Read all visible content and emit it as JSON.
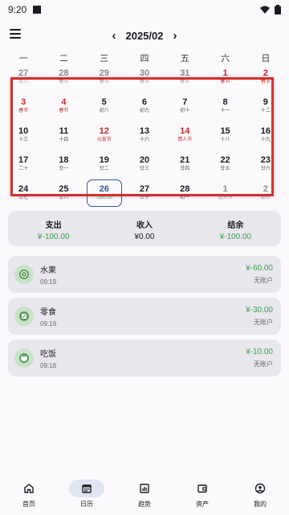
{
  "status": {
    "time": "9:20"
  },
  "header": {
    "month": "2025/02",
    "prev_icon": "chevron-left-icon",
    "next_icon": "chevron-right-icon",
    "menu_icon": "menu-icon"
  },
  "weekdays": [
    "一",
    "二",
    "三",
    "四",
    "五",
    "六",
    "日"
  ],
  "days": [
    {
      "d": "27",
      "s": "廿八",
      "muted": true
    },
    {
      "d": "28",
      "s": "春节",
      "muted": true
    },
    {
      "d": "29",
      "s": "春节",
      "muted": true
    },
    {
      "d": "30",
      "s": "春节",
      "muted": true
    },
    {
      "d": "31",
      "s": "春节",
      "muted": true
    },
    {
      "d": "1",
      "s": "春节",
      "red": true,
      "fest": true
    },
    {
      "d": "2",
      "s": "春节",
      "red": true,
      "fest": true
    },
    {
      "d": "3",
      "s": "春节",
      "red": true,
      "fest": true
    },
    {
      "d": "4",
      "s": "春节",
      "red": true,
      "fest": true
    },
    {
      "d": "5",
      "s": "初八"
    },
    {
      "d": "6",
      "s": "初九"
    },
    {
      "d": "7",
      "s": "初十"
    },
    {
      "d": "8",
      "s": "十一"
    },
    {
      "d": "9",
      "s": "十二"
    },
    {
      "d": "10",
      "s": "十三"
    },
    {
      "d": "11",
      "s": "十四"
    },
    {
      "d": "12",
      "s": "元宵节",
      "red": true,
      "fest": true
    },
    {
      "d": "13",
      "s": "十六"
    },
    {
      "d": "14",
      "s": "情人节",
      "red": true,
      "fest": true
    },
    {
      "d": "15",
      "s": "十八"
    },
    {
      "d": "16",
      "s": "十九"
    },
    {
      "d": "17",
      "s": "二十"
    },
    {
      "d": "18",
      "s": "廿一"
    },
    {
      "d": "19",
      "s": "廿二"
    },
    {
      "d": "20",
      "s": "廿三"
    },
    {
      "d": "21",
      "s": "廿四"
    },
    {
      "d": "22",
      "s": "廿五"
    },
    {
      "d": "23",
      "s": "廿六"
    },
    {
      "d": "24",
      "s": "廿七"
    },
    {
      "d": "25",
      "s": "廿八"
    },
    {
      "d": "26",
      "s": "-100.00",
      "today": true
    },
    {
      "d": "27",
      "s": "三十"
    },
    {
      "d": "28",
      "s": "初一"
    },
    {
      "d": "1",
      "s": "龙头节",
      "muted": true
    },
    {
      "d": "2",
      "s": "初三",
      "muted": true
    }
  ],
  "summary": {
    "expense_label": "支出",
    "expense_value": "¥-100.00",
    "income_label": "收入",
    "income_value": "¥0.00",
    "balance_label": "结余",
    "balance_value": "¥-100.00"
  },
  "records": [
    {
      "icon": "fruit-icon",
      "title": "水果",
      "time": "09:19",
      "amount": "¥-60.00",
      "account": "无账户"
    },
    {
      "icon": "snack-icon",
      "title": "零食",
      "time": "09:19",
      "amount": "¥-30.00",
      "account": "无账户"
    },
    {
      "icon": "meal-icon",
      "title": "吃饭",
      "time": "09:18",
      "amount": "¥-10.00",
      "account": "无账户"
    }
  ],
  "nav": [
    {
      "label": "首页",
      "icon": "home-icon"
    },
    {
      "label": "日历",
      "icon": "calendar-icon",
      "active": true
    },
    {
      "label": "趋势",
      "icon": "chart-icon"
    },
    {
      "label": "资产",
      "icon": "wallet-icon"
    },
    {
      "label": "我的",
      "icon": "profile-icon"
    }
  ],
  "colors": {
    "accent": "#355c9a",
    "holiday": "#c62828",
    "amount": "#3aa14a",
    "highlight": "#d32f2f"
  }
}
